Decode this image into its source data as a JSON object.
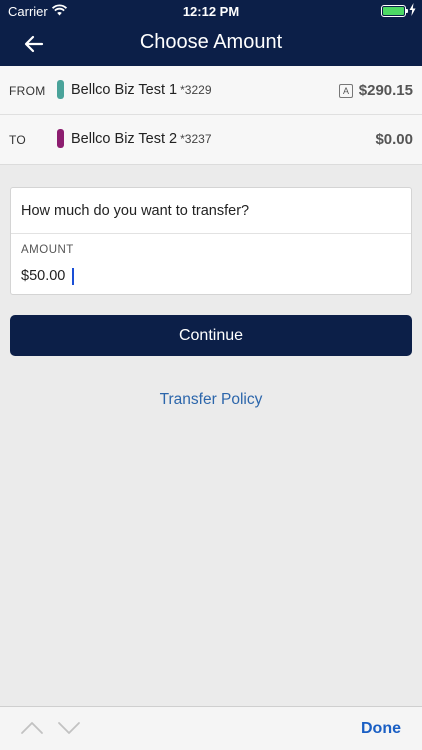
{
  "status_bar": {
    "carrier": "Carrier",
    "time": "12:12 PM",
    "battery_level": 1.0,
    "battery_color": "#4cd964"
  },
  "nav": {
    "title": "Choose Amount",
    "back_icon": "arrow-left-icon"
  },
  "transfer": {
    "from": {
      "label": "FROM",
      "account_name": "Bellco Biz Test 1",
      "account_number": "*3229",
      "badge": "A",
      "balance": "$290.15",
      "color": "#4aa39a"
    },
    "to": {
      "label": "TO",
      "account_name": "Bellco Biz Test 2",
      "account_number": "*3237",
      "balance": "$0.00",
      "color": "#8c1d6f"
    }
  },
  "amount_card": {
    "question": "How much do you want to transfer?",
    "label": "AMOUNT",
    "value": "$50.00"
  },
  "actions": {
    "continue_label": "Continue",
    "policy_label": "Transfer Policy"
  },
  "keyboard_toolbar": {
    "prev_icon": "chevron-up-icon",
    "next_icon": "chevron-down-icon",
    "done_label": "Done"
  },
  "colors": {
    "header": "#0c1f48",
    "link": "#2c66ab",
    "done": "#1a5fc4"
  }
}
